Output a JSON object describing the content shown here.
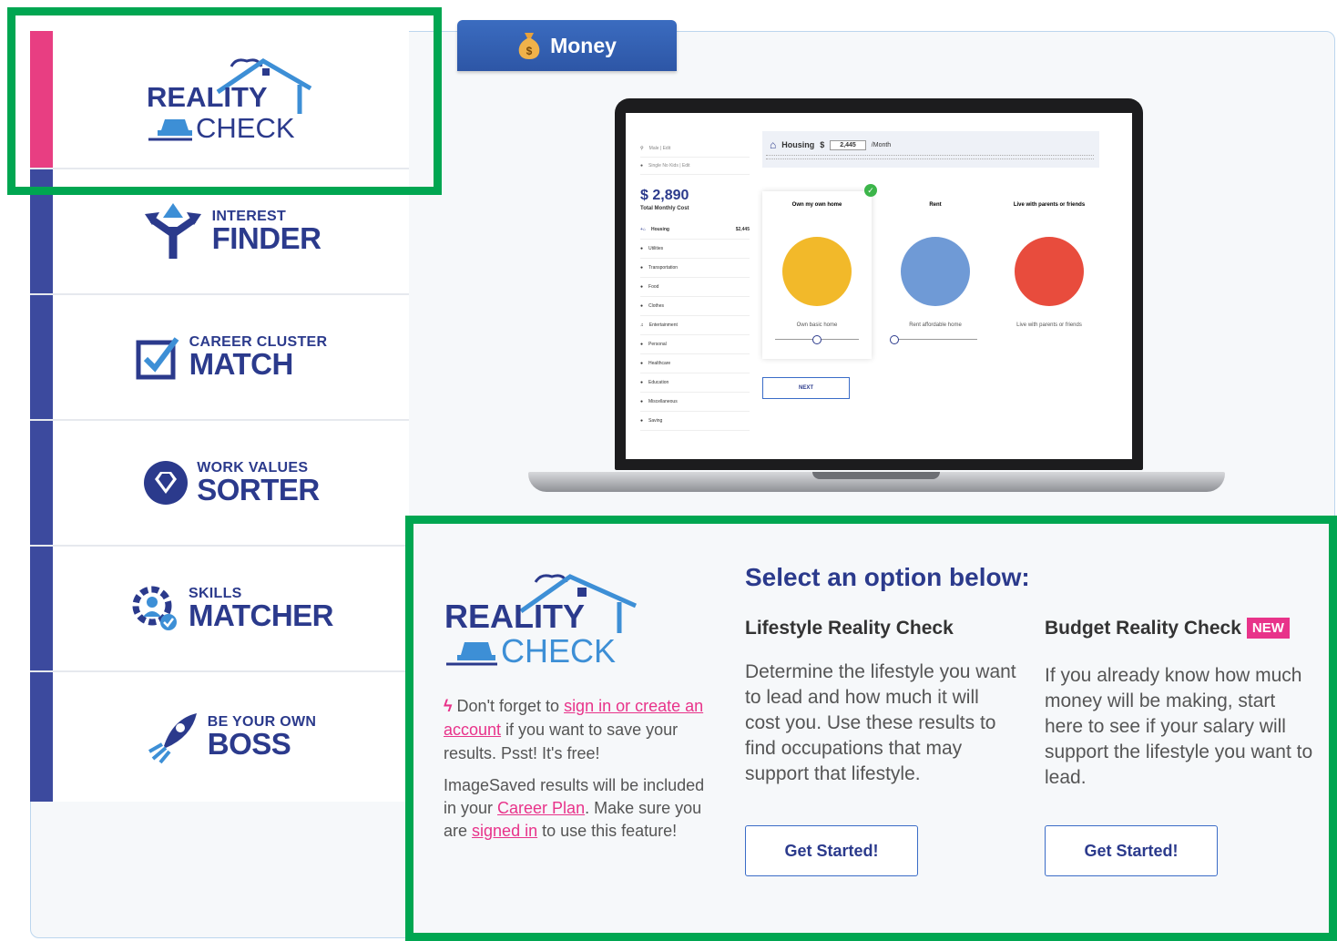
{
  "sidebar": {
    "items": [
      {
        "small": "REALITY",
        "big": "CHECK"
      },
      {
        "small": "INTEREST",
        "big": "FINDER"
      },
      {
        "small": "CAREER CLUSTER",
        "big": "MATCH"
      },
      {
        "small": "WORK VALUES",
        "big": "SORTER"
      },
      {
        "small": "SKILLS",
        "big": "MATCHER"
      },
      {
        "small": "BE YOUR OWN",
        "big": "BOSS"
      }
    ]
  },
  "tab": {
    "label": "Money"
  },
  "preview": {
    "housing_label": "Housing",
    "currency": "$",
    "amount": "2,445",
    "per": "/Month",
    "total": "$ 2,890",
    "total_label": "Total Monthly Cost",
    "options": [
      {
        "title": "Own my own home",
        "caption": "Own basic home"
      },
      {
        "title": "Rent",
        "caption": "Rent affordable home"
      },
      {
        "title": "Live with parents or friends",
        "caption": "Live with parents or friends"
      }
    ],
    "next": "NEXT"
  },
  "main": {
    "logo_top": "REALITY",
    "logo_bottom": "CHECK",
    "reminder_prefix": "Don't forget to ",
    "reminder_link": "sign in or create an account",
    "reminder_suffix": " if you want to save your results. Psst! It's free!",
    "saved_prefix": "ImageSaved results will be included in your ",
    "saved_link1": "Career Plan",
    "saved_mid": ". Make sure you are ",
    "saved_link2": "signed in",
    "saved_suffix": " to use this feature!",
    "select_title": "Select an option below:",
    "lifestyle": {
      "title": "Lifestyle Reality Check",
      "desc": "Determine the lifestyle you want to lead and how much it will cost you. Use these results to find occupations that may support that lifestyle.",
      "button": "Get Started!"
    },
    "budget": {
      "title": "Budget Reality Check",
      "badge": "NEW",
      "desc": "If you already know how much money will be making, start here to see if your salary will support the lifestyle you want to lead.",
      "button": "Get Started!"
    }
  },
  "colors": {
    "accent": "#2b3a8c",
    "pink": "#e8338a",
    "highlight": "#00a651"
  }
}
